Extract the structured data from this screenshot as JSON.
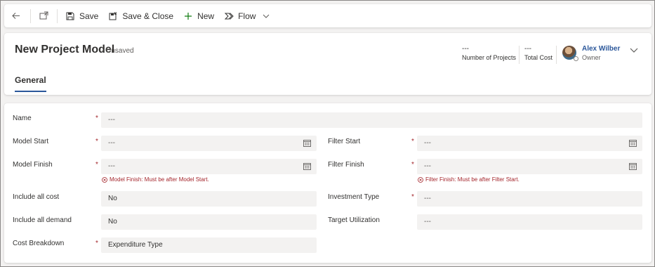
{
  "toolbar": {
    "save_label": "Save",
    "save_close_label": "Save & Close",
    "new_label": "New",
    "flow_label": "Flow"
  },
  "header": {
    "title": "New Project Model",
    "save_status": "- Unsaved",
    "fields": [
      {
        "value": "---",
        "label": "Number of Projects"
      },
      {
        "value": "---",
        "label": "Total Cost"
      }
    ],
    "owner": {
      "name": "Alex Wilber",
      "label": "Owner"
    }
  },
  "tabs": [
    {
      "label": "General"
    }
  ],
  "form": {
    "name": {
      "label": "Name",
      "value": "---"
    },
    "model_start": {
      "label": "Model Start",
      "value": "---"
    },
    "model_finish": {
      "label": "Model Finish",
      "value": "---",
      "error": "Model Finish: Must be after Model Start."
    },
    "include_all_cost": {
      "label": "Include all cost",
      "value": "No"
    },
    "include_all_demand": {
      "label": "Include all demand",
      "value": "No"
    },
    "cost_breakdown": {
      "label": "Cost Breakdown",
      "value": "Expenditure Type"
    },
    "filter_start": {
      "label": "Filter Start",
      "value": "---"
    },
    "filter_finish": {
      "label": "Filter Finish",
      "value": "---",
      "error": "Filter Finish: Must be after Filter Start."
    },
    "investment_type": {
      "label": "Investment Type",
      "value": "---"
    },
    "target_utilization": {
      "label": "Target Utilization",
      "value": "---"
    },
    "required_marker": "*"
  },
  "colors": {
    "accent": "#2b579a",
    "error": "#a4262c",
    "field_bg": "#f3f2f1",
    "new_icon": "#107c10"
  }
}
